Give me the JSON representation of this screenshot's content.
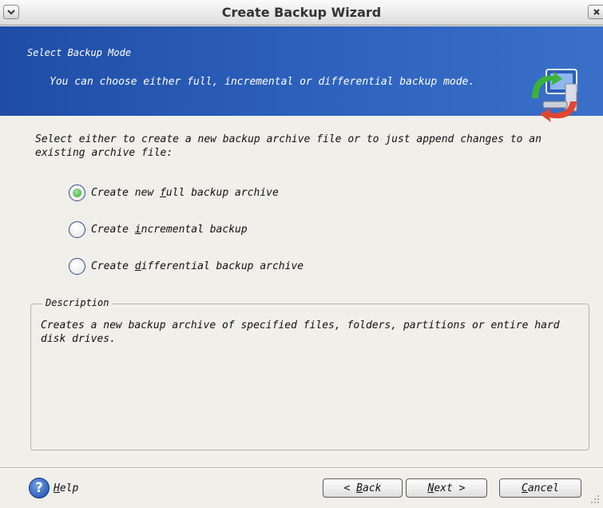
{
  "window": {
    "title": "Create Backup Wizard"
  },
  "header": {
    "title": "Select Backup Mode",
    "description": "You can choose either full, incremental or differential backup mode.",
    "icon": "backup-computer-icon"
  },
  "intro": "Select either to create a new backup archive file or to just append changes to an existing archive file:",
  "options": [
    {
      "pre": "Create new ",
      "mnemonic": "f",
      "post": "ull backup archive",
      "checked": true
    },
    {
      "pre": "Create ",
      "mnemonic": "i",
      "post": "ncremental backup",
      "checked": false
    },
    {
      "pre": "Create ",
      "mnemonic": "d",
      "post": "ifferential backup archive",
      "checked": false
    }
  ],
  "description_group": {
    "legend": "Description",
    "text": "Creates a new backup archive of specified files, folders, partitions or entire hard disk drives."
  },
  "buttons": {
    "help": {
      "mnemonic": "H",
      "rest": "elp"
    },
    "back": {
      "pre": "< ",
      "mnemonic": "B",
      "rest": "ack"
    },
    "next": {
      "pre": "",
      "mnemonic": "N",
      "rest": "ext >"
    },
    "cancel": {
      "pre": "",
      "mnemonic": "C",
      "rest": "ancel"
    }
  },
  "colors": {
    "header_bg": "#2e62bd",
    "radio_selected": "#3aa53a",
    "window_bg": "#f1efea"
  }
}
